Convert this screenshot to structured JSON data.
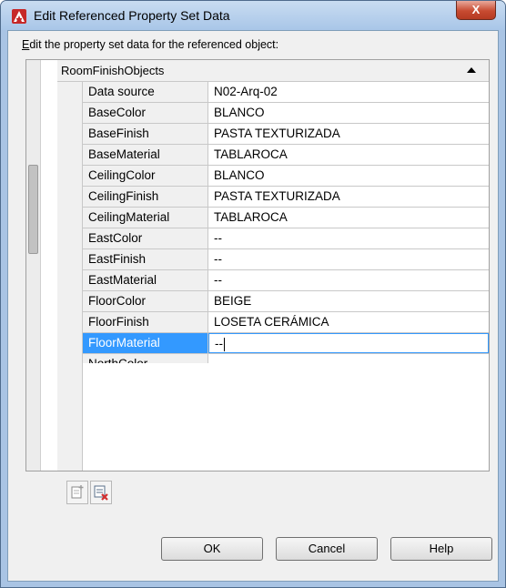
{
  "window": {
    "title": "Edit Referenced Property Set Data",
    "close_label": "X",
    "app_icon": "autocad-icon"
  },
  "prompt": {
    "mnemonic": "E",
    "rest": "dit the property set data for the referenced object:"
  },
  "group": {
    "name": "RoomFinishObjects"
  },
  "rows": [
    {
      "name": "Data source",
      "value": "N02-Arq-02"
    },
    {
      "name": "BaseColor",
      "value": "BLANCO"
    },
    {
      "name": "BaseFinish",
      "value": "PASTA TEXTURIZADA"
    },
    {
      "name": "BaseMaterial",
      "value": "TABLAROCA"
    },
    {
      "name": "CeilingColor",
      "value": "BLANCO"
    },
    {
      "name": "CeilingFinish",
      "value": "PASTA TEXTURIZADA"
    },
    {
      "name": "CeilingMaterial",
      "value": "TABLAROCA"
    },
    {
      "name": "EastColor",
      "value": "--"
    },
    {
      "name": "EastFinish",
      "value": "--"
    },
    {
      "name": "EastMaterial",
      "value": "--"
    },
    {
      "name": "FloorColor",
      "value": "BEIGE"
    },
    {
      "name": "FloorFinish",
      "value": "LOSETA CERÁMICA"
    },
    {
      "name": "FloorMaterial",
      "value": "--"
    },
    {
      "name": "NorthColor",
      "value": ""
    }
  ],
  "selected_row": "FloorMaterial",
  "toolbar": {
    "add_icon": "add-property-set-icon",
    "remove_icon": "remove-property-set-icon"
  },
  "buttons": {
    "ok": "OK",
    "cancel": "Cancel",
    "help": "Help"
  },
  "colors": {
    "selection": "#3399ff",
    "close_button": "#c74b31",
    "titlebar": "#b4cde9"
  }
}
